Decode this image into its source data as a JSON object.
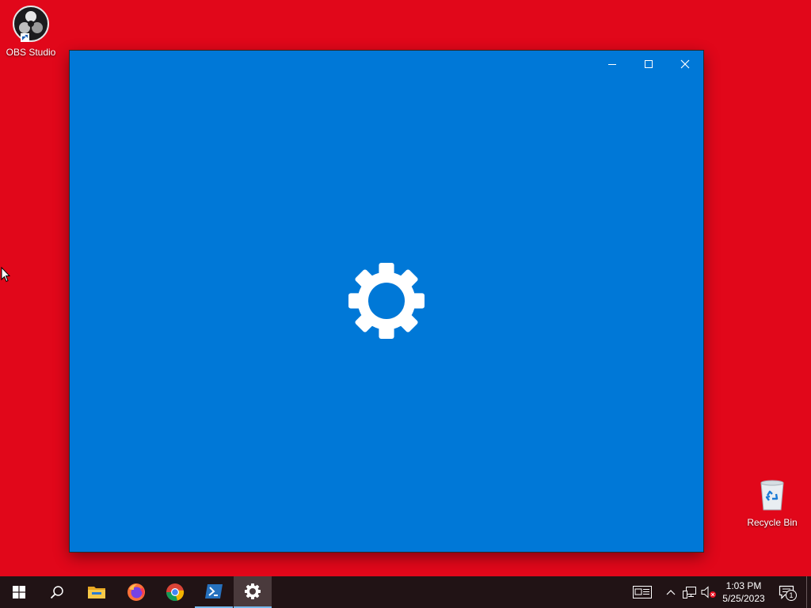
{
  "desktop": {
    "background_color": "#e1071a",
    "icons": [
      {
        "label": "OBS Studio",
        "icon": "obs-logo-icon"
      },
      {
        "label": "Recycle Bin",
        "icon": "recycle-bin-icon"
      }
    ]
  },
  "window": {
    "app": "Settings",
    "state": "splash-screen",
    "background_color": "#0078d7",
    "splash_icon": "gear-icon",
    "caption_buttons": [
      "minimize",
      "maximize",
      "close"
    ]
  },
  "taskbar": {
    "background_color": "#211315",
    "apps": [
      {
        "name": "Start",
        "icon": "windows-logo-icon"
      },
      {
        "name": "Search",
        "icon": "search-icon"
      },
      {
        "name": "File Explorer",
        "icon": "folder-icon"
      },
      {
        "name": "Firefox",
        "icon": "firefox-icon"
      },
      {
        "name": "Google Chrome",
        "icon": "chrome-icon"
      },
      {
        "name": "PowerShell",
        "icon": "powershell-icon"
      },
      {
        "name": "Settings",
        "icon": "gear-icon",
        "active": true
      }
    ],
    "tray": {
      "time": "1:03 PM",
      "date": "5/25/2023",
      "notification_count": "1"
    }
  }
}
